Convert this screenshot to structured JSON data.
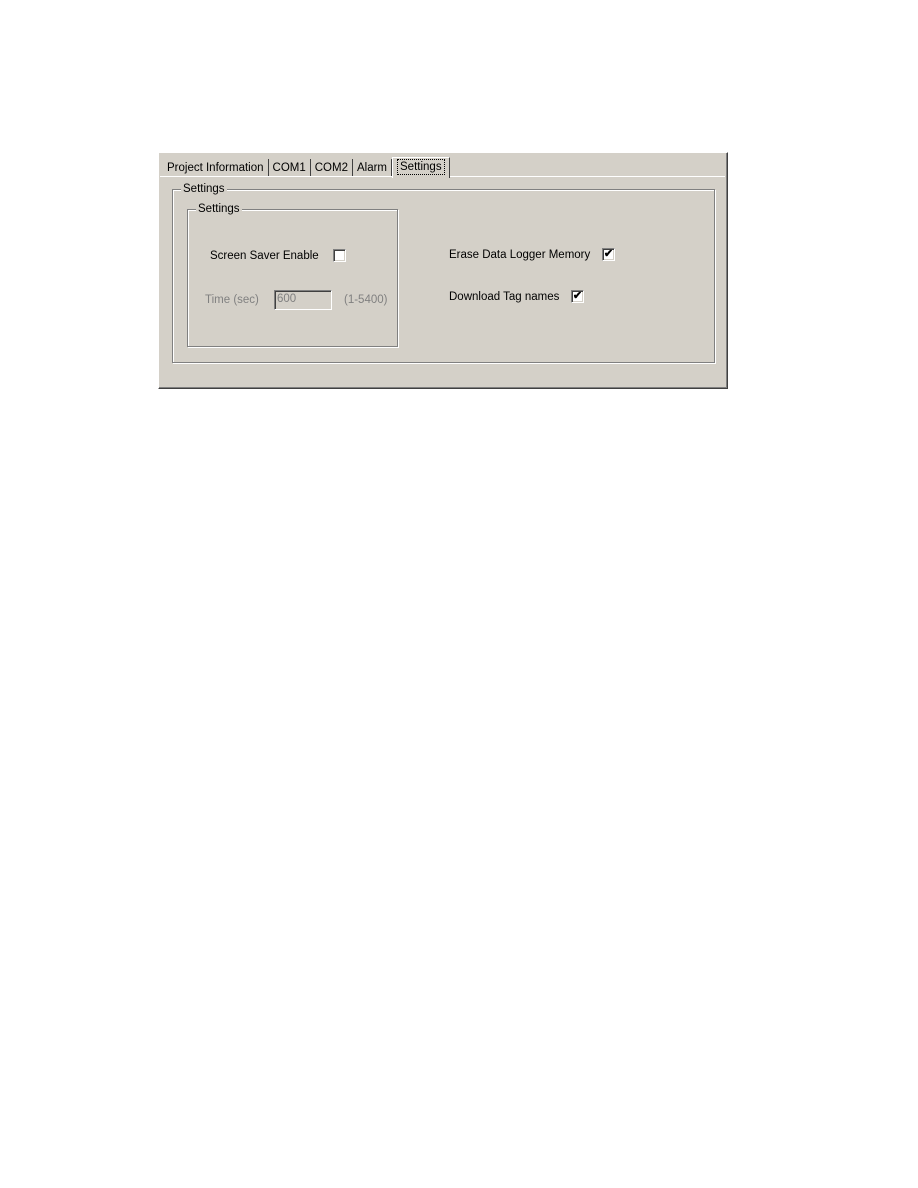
{
  "tabs": [
    {
      "label": "Project Information",
      "active": false
    },
    {
      "label": "COM1",
      "active": false
    },
    {
      "label": "COM2",
      "active": false
    },
    {
      "label": "Alarm",
      "active": false
    },
    {
      "label": "Settings",
      "active": true
    }
  ],
  "outer_group": {
    "title": "Settings"
  },
  "inner_group": {
    "title": "Settings",
    "screen_saver": {
      "label": "Screen Saver Enable",
      "checked": false
    },
    "time": {
      "label": "Time (sec)",
      "value": "600",
      "range": "(1-5400)",
      "enabled": false
    }
  },
  "options": {
    "erase_logger": {
      "label": "Erase Data Logger Memory",
      "checked": true
    },
    "download_tags": {
      "label": "Download Tag names",
      "checked": true
    }
  },
  "check_glyph": "✔"
}
